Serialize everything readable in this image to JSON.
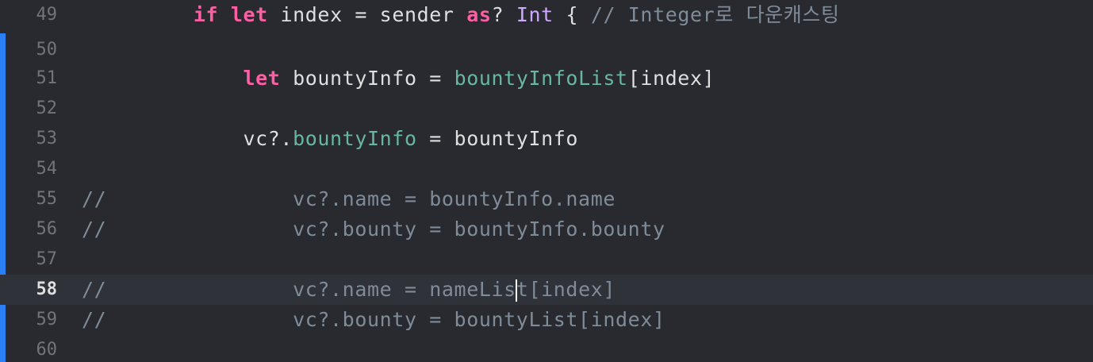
{
  "editor": {
    "current_line": "58",
    "lines": [
      {
        "num": "49",
        "indent": "         ",
        "tokens": [
          "if",
          "let",
          "index = sender",
          "as",
          "?",
          "Int",
          "{",
          "// Integer로 다운캐스팅"
        ]
      },
      {
        "num": "50"
      },
      {
        "num": "51",
        "indent": "             ",
        "tokens": [
          "let",
          "bountyInfo = ",
          "bountyInfoList",
          "[index]"
        ]
      },
      {
        "num": "52"
      },
      {
        "num": "53",
        "indent": "             ",
        "tokens": [
          "vc?.",
          "bountyInfo",
          " = bountyInfo"
        ]
      },
      {
        "num": "54"
      },
      {
        "num": "55",
        "comment_prefix": "//",
        "text": "               vc?.name = bountyInfo.name"
      },
      {
        "num": "56",
        "comment_prefix": "//",
        "text": "               vc?.bounty = bountyInfo.bounty"
      },
      {
        "num": "57"
      },
      {
        "num": "58",
        "comment_prefix": "//",
        "text_before_cursor": "               vc?.name = nameLis",
        "text_after_cursor": "t[index]"
      },
      {
        "num": "59",
        "comment_prefix": "//",
        "text": "               vc?.bounty = bountyList[index]"
      },
      {
        "num": "60"
      }
    ]
  }
}
